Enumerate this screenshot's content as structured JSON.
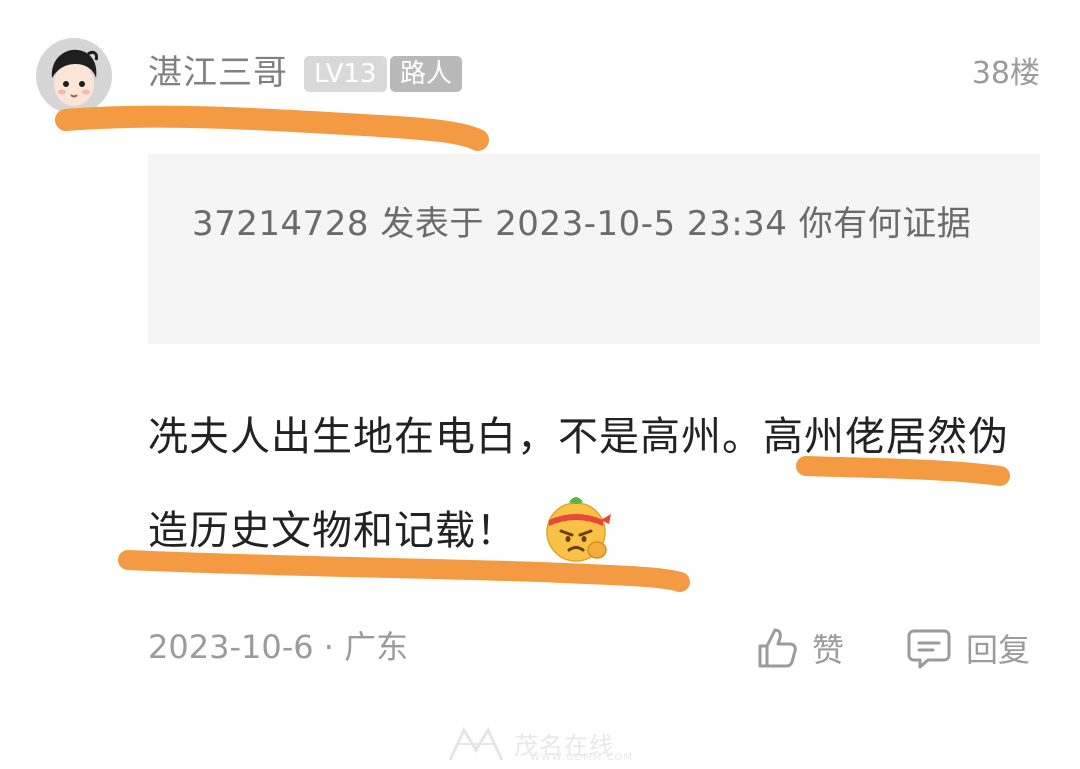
{
  "post": {
    "username": "湛江三哥",
    "level_badge": "LV13",
    "role_badge": "路人",
    "floor": "38楼",
    "quote": "37214728 发表于 2023-10-5 23:34 你有何证据",
    "content": "冼夫人出生地在电白，不是高州。高州佬居然伪造历史文物和记载！",
    "date": "2023-10-6",
    "location": "广东"
  },
  "actions": {
    "like_label": "赞",
    "reply_label": "回复"
  },
  "watermark": {
    "brand": "茂名在线",
    "url": "WWW.GDMM.COM"
  },
  "colors": {
    "highlight_marker": "#f39a43",
    "quote_bg": "#f5f5f5",
    "meta_text": "#9b9b9b"
  },
  "icons": {
    "avatar": "cartoon-person-avatar",
    "emoji": "angry-face-emoji",
    "like": "thumbs-up-icon",
    "reply": "comment-bubble-icon"
  }
}
